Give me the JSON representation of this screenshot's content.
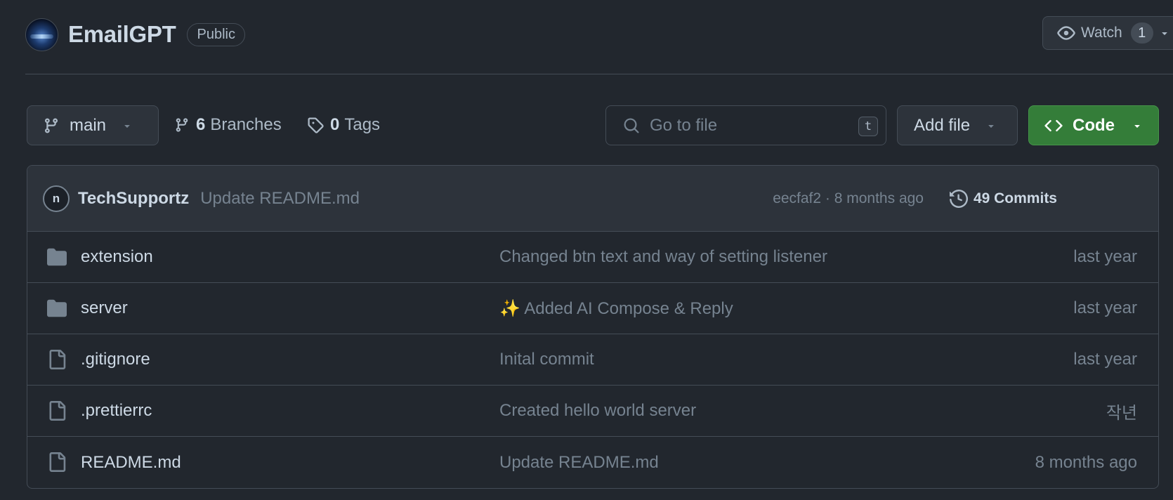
{
  "repo": {
    "name": "EmailGPT",
    "visibility": "Public"
  },
  "watch": {
    "label": "Watch",
    "count": "1"
  },
  "toolbar": {
    "branch": "main",
    "branches_count": "6",
    "branches_label": "Branches",
    "tags_count": "0",
    "tags_label": "Tags",
    "goto_placeholder": "Go to file",
    "goto_shortcut": "t",
    "add_file_label": "Add file",
    "code_label": "Code"
  },
  "latest_commit": {
    "avatar_letter": "n",
    "author": "TechSupportz",
    "message": "Update README.md",
    "hash_and_time": "eecfaf2 · 8 months ago",
    "commits_label": "49 Commits"
  },
  "files": [
    {
      "type": "folder",
      "name": "extension",
      "commit": "Changed btn text and way of setting listener",
      "date": "last year"
    },
    {
      "type": "folder",
      "name": "server",
      "commit": "✨ Added AI Compose & Reply",
      "date": "last year"
    },
    {
      "type": "file",
      "name": ".gitignore",
      "commit": "Inital commit",
      "date": "last year"
    },
    {
      "type": "file",
      "name": ".prettierrc",
      "commit": "Created hello world server",
      "date": "작년"
    },
    {
      "type": "file",
      "name": "README.md",
      "commit": "Update README.md",
      "date": "8 months ago"
    }
  ],
  "colors": {
    "background": "#22272e",
    "surface": "#2d333b",
    "border": "#444c56",
    "text_primary": "#cdd9e5",
    "text_muted": "#768390",
    "code_button": "#347d39"
  },
  "icons": {
    "eye": "eye-icon",
    "branch": "git-branch-icon",
    "tag": "tag-icon",
    "search": "search-icon",
    "code": "code-icon",
    "history": "history-icon",
    "folder": "folder-icon",
    "file": "file-icon"
  }
}
